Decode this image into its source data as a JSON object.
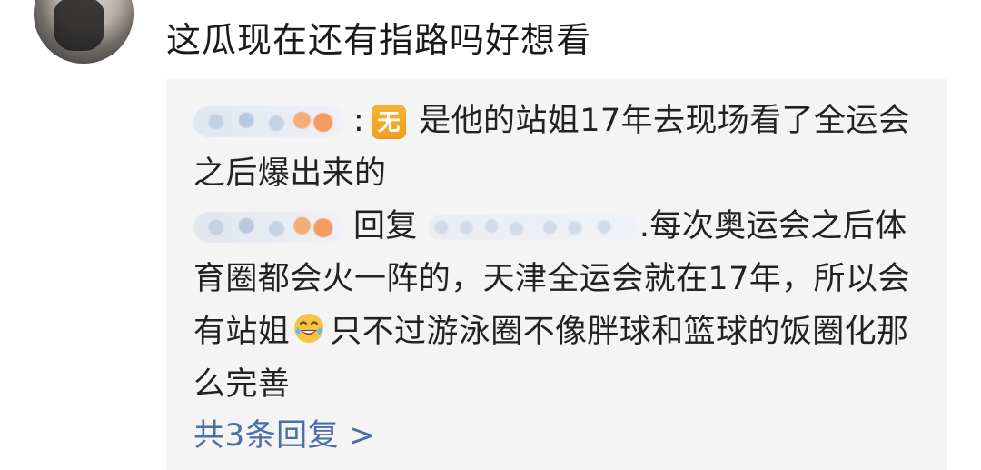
{
  "comment": {
    "text": "这瓜现在还有指路吗好想看"
  },
  "replies": [
    {
      "colon": ":",
      "badge_icon": "无",
      "text": "是他的站姐17年去现场看了全运会之后爆出来的"
    },
    {
      "reply_word": "回复",
      "text_before_emoji": ".每次奥运会之后体育圈都会火一阵的，天津全运会就在17年，所以会有站姐",
      "emoji_icon": "laughing-crying-face-icon",
      "text_after_emoji": "只不过游泳圈不像胖球和篮球的饭圈化那么完善"
    }
  ],
  "more_replies": {
    "label": "共3条回复 >"
  },
  "colors": {
    "background": "#ffffff",
    "card_background": "#f4f4f4",
    "text": "#1a1a1a",
    "link": "#4b6ea8",
    "badge_orange": "#f2a423"
  }
}
